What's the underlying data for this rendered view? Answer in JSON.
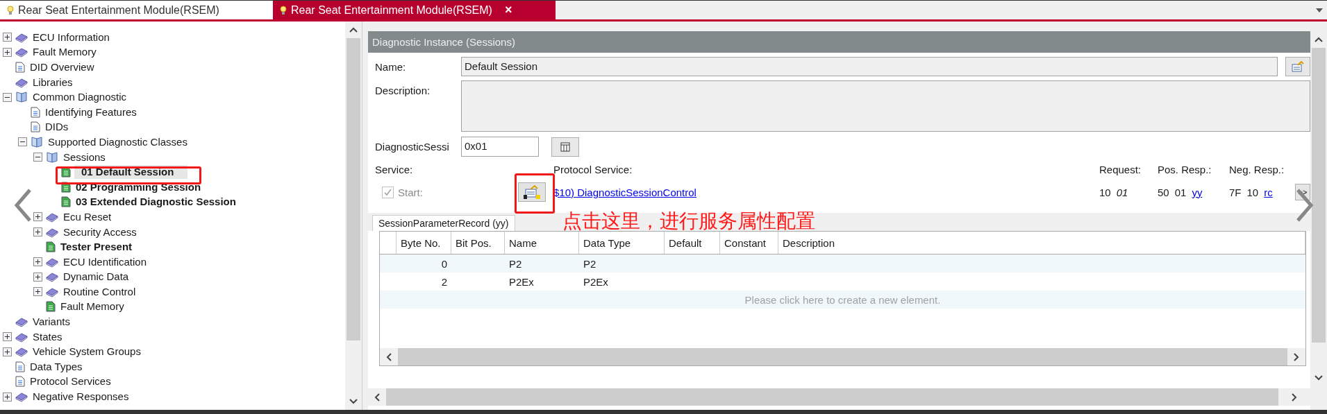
{
  "tabs": [
    {
      "label": "Rear Seat Entertainment Module(RSEM)",
      "selected": false
    },
    {
      "label": "Rear Seat Entertainment Module(RSEM)",
      "selected": true,
      "close": "×"
    }
  ],
  "tree": [
    {
      "label": "ECU Information",
      "kind": "book",
      "expanded": false,
      "selected": false,
      "bold": false
    },
    {
      "label": "Fault Memory",
      "kind": "book",
      "expanded": false,
      "selected": false,
      "bold": false
    },
    {
      "label": "DID Overview",
      "kind": "doc",
      "selected": false,
      "bold": false
    },
    {
      "label": "Libraries",
      "kind": "book",
      "selected": false,
      "bold": false
    },
    {
      "label": "Common Diagnostic",
      "kind": "open-book",
      "expanded": true,
      "selected": false,
      "bold": false,
      "children": [
        {
          "label": "Identifying Features",
          "kind": "doc",
          "selected": false,
          "bold": false
        },
        {
          "label": "DIDs",
          "kind": "doc",
          "selected": false,
          "bold": false
        },
        {
          "label": "Supported Diagnostic Classes",
          "kind": "open-book",
          "expanded": true,
          "selected": false,
          "bold": false,
          "children": [
            {
              "label": "Sessions",
              "kind": "open-book",
              "expanded": true,
              "selected": false,
              "bold": false,
              "children": [
                {
                  "label": "01 Default Session",
                  "kind": "green-doc",
                  "selected": true,
                  "bold": true
                },
                {
                  "label": "02 Programming Session",
                  "kind": "green-doc",
                  "selected": false,
                  "bold": true
                },
                {
                  "label": "03 Extended Diagnostic Session",
                  "kind": "green-doc",
                  "selected": false,
                  "bold": true
                }
              ]
            },
            {
              "label": "Ecu Reset",
              "kind": "book",
              "expanded": false,
              "selected": false,
              "bold": false
            },
            {
              "label": "Security Access",
              "kind": "book",
              "expanded": false,
              "selected": false,
              "bold": false
            },
            {
              "label": "Tester Present",
              "kind": "green-doc",
              "selected": false,
              "bold": true
            },
            {
              "label": "ECU Identification",
              "kind": "book",
              "expanded": false,
              "selected": false,
              "bold": false
            },
            {
              "label": "Dynamic Data",
              "kind": "book",
              "expanded": false,
              "selected": false,
              "bold": false
            },
            {
              "label": "Routine Control",
              "kind": "book",
              "expanded": false,
              "selected": false,
              "bold": false
            },
            {
              "label": "Fault Memory",
              "kind": "green-doc",
              "selected": false,
              "bold": false
            }
          ]
        }
      ]
    },
    {
      "label": "Variants",
      "kind": "book",
      "selected": false,
      "bold": false
    },
    {
      "label": "States",
      "kind": "book",
      "expanded": false,
      "selected": false,
      "bold": false
    },
    {
      "label": "Vehicle System Groups",
      "kind": "book",
      "expanded": false,
      "selected": false,
      "bold": false
    },
    {
      "label": "Data Types",
      "kind": "doc",
      "selected": false,
      "bold": false
    },
    {
      "label": "Protocol Services",
      "kind": "doc",
      "selected": false,
      "bold": false
    },
    {
      "label": "Negative Responses",
      "kind": "book",
      "expanded": false,
      "selected": false,
      "bold": false
    }
  ],
  "panel": {
    "title": "Diagnostic Instance (Sessions)",
    "name": {
      "label": "Name:",
      "value": "Default Session"
    },
    "description": {
      "label": "Description:"
    },
    "session": {
      "label": "DiagnosticSessi",
      "value": "0x01"
    },
    "service": {
      "label": "Service:",
      "start": {
        "label": "Start:",
        "checked": true,
        "disabled": true
      }
    },
    "protocol_service": {
      "label": "Protocol Service:",
      "link": "$10) DiagnosticSessionControl"
    },
    "messages": [
      {
        "label": "Request:",
        "bytes": [
          {
            "text": "10",
            "kind": "plain"
          },
          {
            "text": "01",
            "kind": "param"
          }
        ]
      },
      {
        "label": "Pos. Resp.:",
        "bytes": [
          {
            "text": "50",
            "kind": "plain"
          },
          {
            "text": "01",
            "kind": "plain"
          },
          {
            "text": "yy",
            "kind": "link"
          }
        ]
      },
      {
        "label": "Neg. Resp.:",
        "bytes": [
          {
            "text": "7F",
            "kind": "plain"
          },
          {
            "text": "10",
            "kind": "plain"
          },
          {
            "text": "rc",
            "kind": "link"
          }
        ]
      }
    ],
    "more_button": ">>",
    "record_tabs": [
      {
        "label": "SessionParameterRecord (yy)",
        "selected": true
      }
    ],
    "table": {
      "columns": [
        "Byte No.",
        "Bit Pos.",
        "Name",
        "Data Type",
        "Default",
        "Constant",
        "Description"
      ],
      "rows": [
        {
          "byte_no": "0",
          "name": "P2",
          "data_type": "P2"
        },
        {
          "byte_no": "2",
          "name": "P2Ex",
          "data_type": "P2Ex"
        }
      ],
      "new_row_hint": "Please click here to create a new element."
    }
  },
  "annotation": {
    "text": "点击这里，进行服务属性配置"
  }
}
